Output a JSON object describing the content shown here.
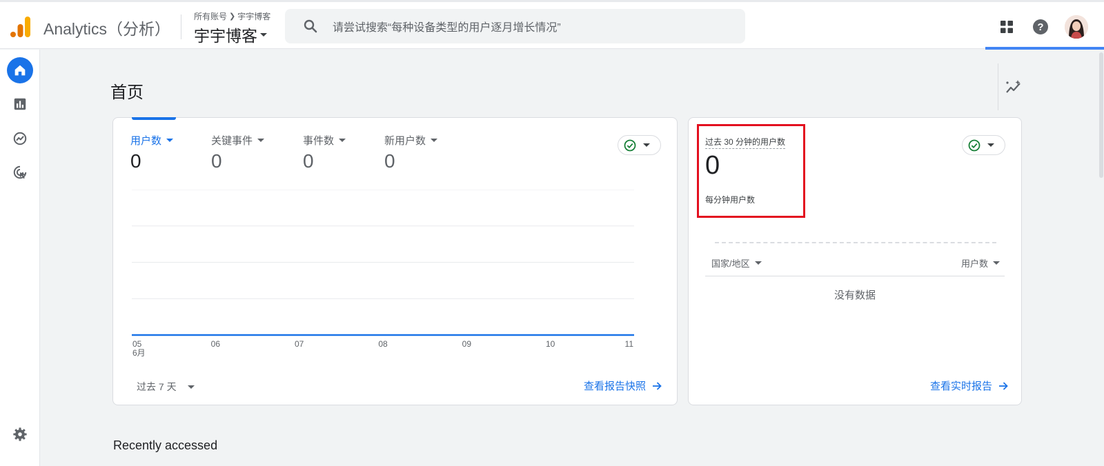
{
  "header": {
    "app_title": "Analytics（分析）",
    "breadcrumb_account": "所有账号",
    "breadcrumb_property": "宇宇博客",
    "property_name": "宇宇博客",
    "search_placeholder": "请尝试搜索“每种设备类型的用户逐月增长情况”",
    "icons": [
      "apps-grid-icon",
      "help-icon"
    ],
    "avatar": "user-avatar"
  },
  "sidebar": {
    "items": [
      {
        "name": "home",
        "icon": "home-icon",
        "active": true
      },
      {
        "name": "reports",
        "icon": "bar-chart-icon",
        "active": false
      },
      {
        "name": "explore",
        "icon": "explore-icon",
        "active": false
      },
      {
        "name": "advertising",
        "icon": "advertising-icon",
        "active": false
      }
    ],
    "settings_icon": "gear-icon"
  },
  "page": {
    "title": "首页",
    "recently_accessed": "Recently accessed"
  },
  "overview": {
    "metrics": [
      {
        "label": "用户数",
        "value": "0",
        "active": true
      },
      {
        "label": "关键事件",
        "value": "0",
        "active": false
      },
      {
        "label": "事件数",
        "value": "0",
        "active": false
      },
      {
        "label": "新用户数",
        "value": "0",
        "active": false
      }
    ],
    "date_range": "过去 7 天",
    "link": "查看报告快照",
    "status": "check-circle-icon"
  },
  "realtime": {
    "label": "过去 30 分钟的用户数",
    "value": "0",
    "sublabel": "每分钟用户数",
    "columns": [
      "国家/地区",
      "用户数"
    ],
    "empty": "没有数据",
    "link": "查看实时报告"
  },
  "chart_data": {
    "type": "line",
    "x": [
      "05",
      "06",
      "07",
      "08",
      "09",
      "10",
      "11"
    ],
    "x_sublabel": "6月",
    "series": [
      {
        "values": [
          0,
          0,
          0,
          0,
          0,
          0,
          0
        ]
      }
    ],
    "ylim": [
      0,
      4
    ],
    "grid": true,
    "color": "#1a73e8"
  }
}
